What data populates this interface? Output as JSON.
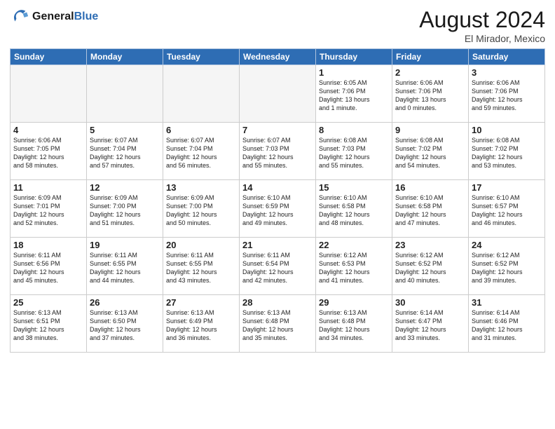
{
  "header": {
    "logo_general": "General",
    "logo_blue": "Blue",
    "month_title": "August 2024",
    "subtitle": "El Mirador, Mexico"
  },
  "days_of_week": [
    "Sunday",
    "Monday",
    "Tuesday",
    "Wednesday",
    "Thursday",
    "Friday",
    "Saturday"
  ],
  "weeks": [
    [
      {
        "day": "",
        "info": ""
      },
      {
        "day": "",
        "info": ""
      },
      {
        "day": "",
        "info": ""
      },
      {
        "day": "",
        "info": ""
      },
      {
        "day": "1",
        "info": "Sunrise: 6:05 AM\nSunset: 7:06 PM\nDaylight: 13 hours\nand 1 minute."
      },
      {
        "day": "2",
        "info": "Sunrise: 6:06 AM\nSunset: 7:06 PM\nDaylight: 13 hours\nand 0 minutes."
      },
      {
        "day": "3",
        "info": "Sunrise: 6:06 AM\nSunset: 7:06 PM\nDaylight: 12 hours\nand 59 minutes."
      }
    ],
    [
      {
        "day": "4",
        "info": "Sunrise: 6:06 AM\nSunset: 7:05 PM\nDaylight: 12 hours\nand 58 minutes."
      },
      {
        "day": "5",
        "info": "Sunrise: 6:07 AM\nSunset: 7:04 PM\nDaylight: 12 hours\nand 57 minutes."
      },
      {
        "day": "6",
        "info": "Sunrise: 6:07 AM\nSunset: 7:04 PM\nDaylight: 12 hours\nand 56 minutes."
      },
      {
        "day": "7",
        "info": "Sunrise: 6:07 AM\nSunset: 7:03 PM\nDaylight: 12 hours\nand 55 minutes."
      },
      {
        "day": "8",
        "info": "Sunrise: 6:08 AM\nSunset: 7:03 PM\nDaylight: 12 hours\nand 55 minutes."
      },
      {
        "day": "9",
        "info": "Sunrise: 6:08 AM\nSunset: 7:02 PM\nDaylight: 12 hours\nand 54 minutes."
      },
      {
        "day": "10",
        "info": "Sunrise: 6:08 AM\nSunset: 7:02 PM\nDaylight: 12 hours\nand 53 minutes."
      }
    ],
    [
      {
        "day": "11",
        "info": "Sunrise: 6:09 AM\nSunset: 7:01 PM\nDaylight: 12 hours\nand 52 minutes."
      },
      {
        "day": "12",
        "info": "Sunrise: 6:09 AM\nSunset: 7:00 PM\nDaylight: 12 hours\nand 51 minutes."
      },
      {
        "day": "13",
        "info": "Sunrise: 6:09 AM\nSunset: 7:00 PM\nDaylight: 12 hours\nand 50 minutes."
      },
      {
        "day": "14",
        "info": "Sunrise: 6:10 AM\nSunset: 6:59 PM\nDaylight: 12 hours\nand 49 minutes."
      },
      {
        "day": "15",
        "info": "Sunrise: 6:10 AM\nSunset: 6:58 PM\nDaylight: 12 hours\nand 48 minutes."
      },
      {
        "day": "16",
        "info": "Sunrise: 6:10 AM\nSunset: 6:58 PM\nDaylight: 12 hours\nand 47 minutes."
      },
      {
        "day": "17",
        "info": "Sunrise: 6:10 AM\nSunset: 6:57 PM\nDaylight: 12 hours\nand 46 minutes."
      }
    ],
    [
      {
        "day": "18",
        "info": "Sunrise: 6:11 AM\nSunset: 6:56 PM\nDaylight: 12 hours\nand 45 minutes."
      },
      {
        "day": "19",
        "info": "Sunrise: 6:11 AM\nSunset: 6:55 PM\nDaylight: 12 hours\nand 44 minutes."
      },
      {
        "day": "20",
        "info": "Sunrise: 6:11 AM\nSunset: 6:55 PM\nDaylight: 12 hours\nand 43 minutes."
      },
      {
        "day": "21",
        "info": "Sunrise: 6:11 AM\nSunset: 6:54 PM\nDaylight: 12 hours\nand 42 minutes."
      },
      {
        "day": "22",
        "info": "Sunrise: 6:12 AM\nSunset: 6:53 PM\nDaylight: 12 hours\nand 41 minutes."
      },
      {
        "day": "23",
        "info": "Sunrise: 6:12 AM\nSunset: 6:52 PM\nDaylight: 12 hours\nand 40 minutes."
      },
      {
        "day": "24",
        "info": "Sunrise: 6:12 AM\nSunset: 6:52 PM\nDaylight: 12 hours\nand 39 minutes."
      }
    ],
    [
      {
        "day": "25",
        "info": "Sunrise: 6:13 AM\nSunset: 6:51 PM\nDaylight: 12 hours\nand 38 minutes."
      },
      {
        "day": "26",
        "info": "Sunrise: 6:13 AM\nSunset: 6:50 PM\nDaylight: 12 hours\nand 37 minutes."
      },
      {
        "day": "27",
        "info": "Sunrise: 6:13 AM\nSunset: 6:49 PM\nDaylight: 12 hours\nand 36 minutes."
      },
      {
        "day": "28",
        "info": "Sunrise: 6:13 AM\nSunset: 6:48 PM\nDaylight: 12 hours\nand 35 minutes."
      },
      {
        "day": "29",
        "info": "Sunrise: 6:13 AM\nSunset: 6:48 PM\nDaylight: 12 hours\nand 34 minutes."
      },
      {
        "day": "30",
        "info": "Sunrise: 6:14 AM\nSunset: 6:47 PM\nDaylight: 12 hours\nand 33 minutes."
      },
      {
        "day": "31",
        "info": "Sunrise: 6:14 AM\nSunset: 6:46 PM\nDaylight: 12 hours\nand 31 minutes."
      }
    ]
  ]
}
